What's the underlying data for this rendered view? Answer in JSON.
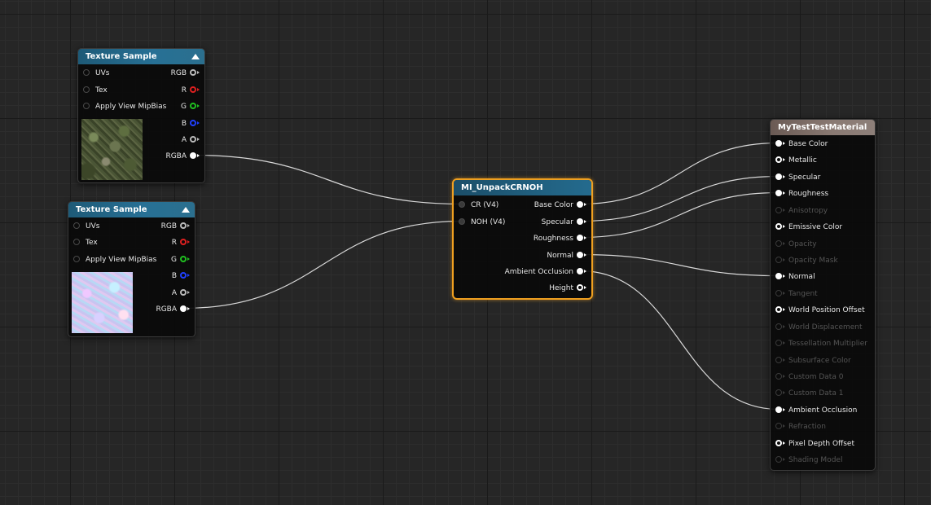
{
  "graph": {
    "texture_sample_1": {
      "title": "Texture Sample",
      "inputs": [
        "UVs",
        "Tex",
        "Apply View MipBias"
      ],
      "outputs": [
        "RGB",
        "R",
        "G",
        "B",
        "A",
        "RGBA"
      ],
      "preview": "ground-texture-preview"
    },
    "texture_sample_2": {
      "title": "Texture Sample",
      "inputs": [
        "UVs",
        "Tex",
        "Apply View MipBias"
      ],
      "outputs": [
        "RGB",
        "R",
        "G",
        "B",
        "A",
        "RGBA"
      ],
      "preview": "normal-map-preview"
    },
    "unpack_function": {
      "title": "MI_UnpackCRNOH",
      "inputs": [
        "CR (V4)",
        "NOH (V4)"
      ],
      "outputs": [
        "Base Color",
        "Specular",
        "Roughness",
        "Normal",
        "Ambient Occlusion",
        "Height"
      ]
    },
    "material": {
      "title": "MyTestTestMaterial",
      "inputs": [
        {
          "label": "Base Color",
          "enabled": true,
          "connected": true
        },
        {
          "label": "Metallic",
          "enabled": true,
          "connected": false
        },
        {
          "label": "Specular",
          "enabled": true,
          "connected": true
        },
        {
          "label": "Roughness",
          "enabled": true,
          "connected": true
        },
        {
          "label": "Anisotropy",
          "enabled": false,
          "connected": false
        },
        {
          "label": "Emissive Color",
          "enabled": true,
          "connected": false
        },
        {
          "label": "Opacity",
          "enabled": false,
          "connected": false
        },
        {
          "label": "Opacity Mask",
          "enabled": false,
          "connected": false
        },
        {
          "label": "Normal",
          "enabled": true,
          "connected": true
        },
        {
          "label": "Tangent",
          "enabled": false,
          "connected": false
        },
        {
          "label": "World Position Offset",
          "enabled": true,
          "connected": false
        },
        {
          "label": "World Displacement",
          "enabled": false,
          "connected": false
        },
        {
          "label": "Tessellation Multiplier",
          "enabled": false,
          "connected": false
        },
        {
          "label": "Subsurface Color",
          "enabled": false,
          "connected": false
        },
        {
          "label": "Custom Data 0",
          "enabled": false,
          "connected": false
        },
        {
          "label": "Custom Data 1",
          "enabled": false,
          "connected": false
        },
        {
          "label": "Ambient Occlusion",
          "enabled": true,
          "connected": true
        },
        {
          "label": "Refraction",
          "enabled": false,
          "connected": false
        },
        {
          "label": "Pixel Depth Offset",
          "enabled": true,
          "connected": false
        },
        {
          "label": "Shading Model",
          "enabled": false,
          "connected": false
        }
      ]
    },
    "colors": {
      "pin_red": "#e02020",
      "pin_green": "#20c020",
      "pin_blue": "#2040ff",
      "pin_gray": "#bbbbbb",
      "selection": "#f0a020",
      "wire": "#d8d8d8"
    },
    "connections": [
      {
        "from": "texture_sample_1.RGBA",
        "to": "unpack_function.CR (V4)"
      },
      {
        "from": "texture_sample_2.RGBA",
        "to": "unpack_function.NOH (V4)"
      },
      {
        "from": "unpack_function.Base Color",
        "to": "material.Base Color"
      },
      {
        "from": "unpack_function.Specular",
        "to": "material.Specular"
      },
      {
        "from": "unpack_function.Roughness",
        "to": "material.Roughness"
      },
      {
        "from": "unpack_function.Normal",
        "to": "material.Normal"
      },
      {
        "from": "unpack_function.Ambient Occlusion",
        "to": "material.Ambient Occlusion"
      }
    ]
  }
}
